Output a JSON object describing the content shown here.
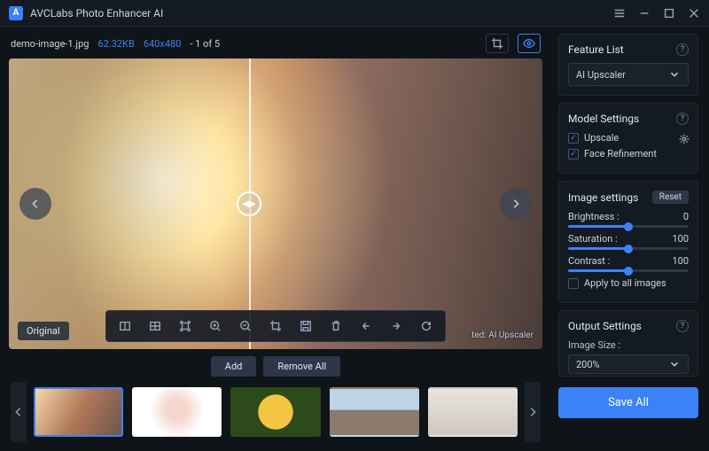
{
  "app": {
    "title": "AVCLabs Photo Enhancer AI"
  },
  "file": {
    "name": "demo-image-1.jpg",
    "size": "62.32KB",
    "dimensions": "640x480",
    "index": "- 1 of 5"
  },
  "preview": {
    "original_tag": "Original",
    "method_tag": "ted: AI Upscaler"
  },
  "strip": {
    "add": "Add",
    "remove_all": "Remove All"
  },
  "feature": {
    "title": "Feature List",
    "selected": "AI Upscaler"
  },
  "model": {
    "title": "Model Settings",
    "upscale": "Upscale",
    "face": "Face Refinement",
    "upscale_checked": true,
    "face_checked": true
  },
  "image_settings": {
    "title": "Image settings",
    "reset": "Reset",
    "brightness_label": "Brightness :",
    "brightness_value": "0",
    "brightness_pct": 50,
    "saturation_label": "Saturation :",
    "saturation_value": "100",
    "saturation_pct": 50,
    "contrast_label": "Contrast :",
    "contrast_value": "100",
    "contrast_pct": 50,
    "apply_all": "Apply to all images",
    "apply_all_checked": false
  },
  "output": {
    "title": "Output Settings",
    "size_label": "Image Size :",
    "size_value": "200%"
  },
  "save": "Save All"
}
